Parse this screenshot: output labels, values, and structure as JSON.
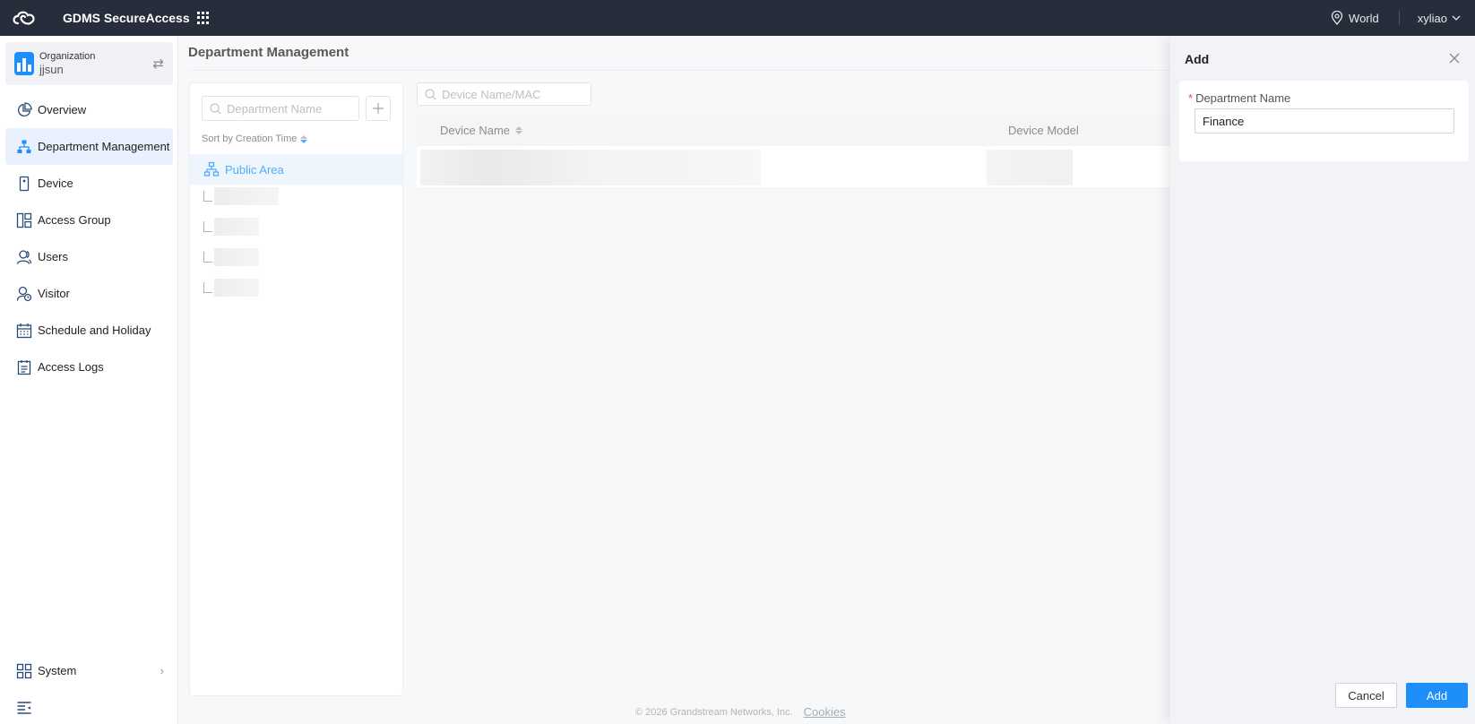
{
  "topbar": {
    "app_title": "GDMS SecureAccess",
    "site": "World",
    "user": "xyliao"
  },
  "sidebar": {
    "org_label": "Organization",
    "org_name": "jjsun",
    "items": [
      {
        "label": "Overview",
        "icon": "pie-chart-icon"
      },
      {
        "label": "Department Management",
        "icon": "org-chart-icon",
        "active": true
      },
      {
        "label": "Device",
        "icon": "device-icon"
      },
      {
        "label": "Access Group",
        "icon": "access-group-icon"
      },
      {
        "label": "Users",
        "icon": "users-icon"
      },
      {
        "label": "Visitor",
        "icon": "visitor-icon"
      },
      {
        "label": "Schedule and Holiday",
        "icon": "calendar-icon"
      },
      {
        "label": "Access Logs",
        "icon": "logs-icon"
      }
    ],
    "system_label": "System"
  },
  "main": {
    "page_title": "Department Management",
    "dept_search_placeholder": "Department Name",
    "sort_label": "Sort by Creation Time",
    "public_area": "Public Area",
    "device_search_placeholder": "Device Name/MAC",
    "columns": {
      "device_name": "Device Name",
      "device_model": "Device Model"
    },
    "footer": "© 2026 Grandstream Networks, Inc.",
    "cookies": "Cookies"
  },
  "drawer": {
    "title": "Add",
    "field_label": "Department Name",
    "required_mark": "*",
    "field_value": "Finance",
    "cancel": "Cancel",
    "add": "Add"
  },
  "colors": {
    "topbar": "#272d3a",
    "accent": "#1e8efb",
    "active_bg": "#e8f1fd"
  }
}
